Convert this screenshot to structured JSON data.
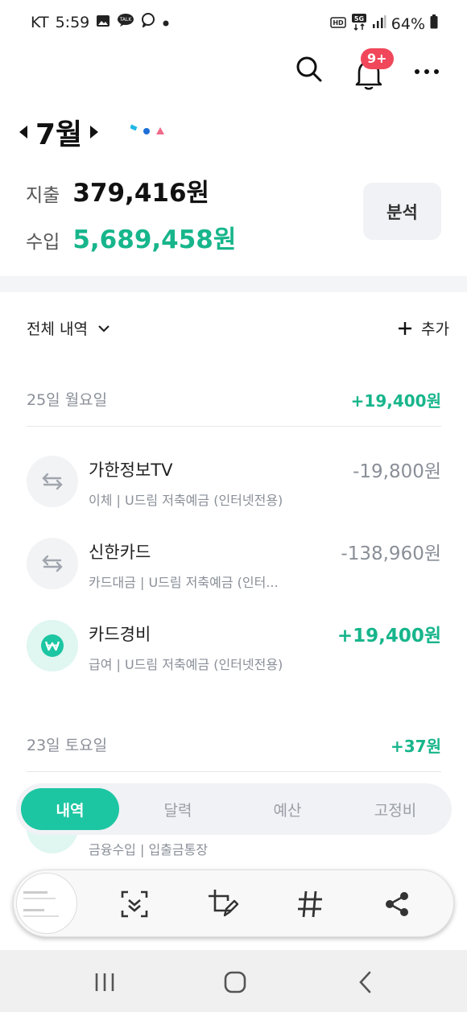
{
  "status_bar": {
    "carrier": "KT",
    "time": "5:59",
    "battery": "64%"
  },
  "header": {
    "notification_badge": "9+",
    "month_label": "7월"
  },
  "summary": {
    "expense_label": "지출",
    "expense_value": "379,416원",
    "income_label": "수입",
    "income_value": "5,689,458원",
    "analysis_button": "분석",
    "colors": {
      "income": "#17b58b"
    }
  },
  "list": {
    "filter_label": "전체 내역",
    "add_label": "추가",
    "days": [
      {
        "date": "25일 월요일",
        "total": "+19,400원",
        "transactions": [
          {
            "name": "가한정보TV",
            "sub": "이체 | U드림 저축예금 (인터넷전용)",
            "amount": "-19,800원",
            "icon": "transfer-icon"
          },
          {
            "name": "신한카드",
            "sub": "카드대금 | U드림 저축예금 (인터...",
            "amount": "-138,960원",
            "icon": "transfer-icon"
          },
          {
            "name": "카드경비",
            "sub": "급여 | U드림 저축예금 (인터넷전용)",
            "amount": "+19,400원",
            "icon": "won-icon"
          }
        ]
      },
      {
        "date": "23일 토요일",
        "total": "+37원",
        "transactions": [
          {
            "sub": "금융수입 | 입출금통장"
          }
        ]
      }
    ]
  },
  "tabs": [
    "내역",
    "달력",
    "예산",
    "고정비"
  ],
  "accent": "#1cc6a2"
}
